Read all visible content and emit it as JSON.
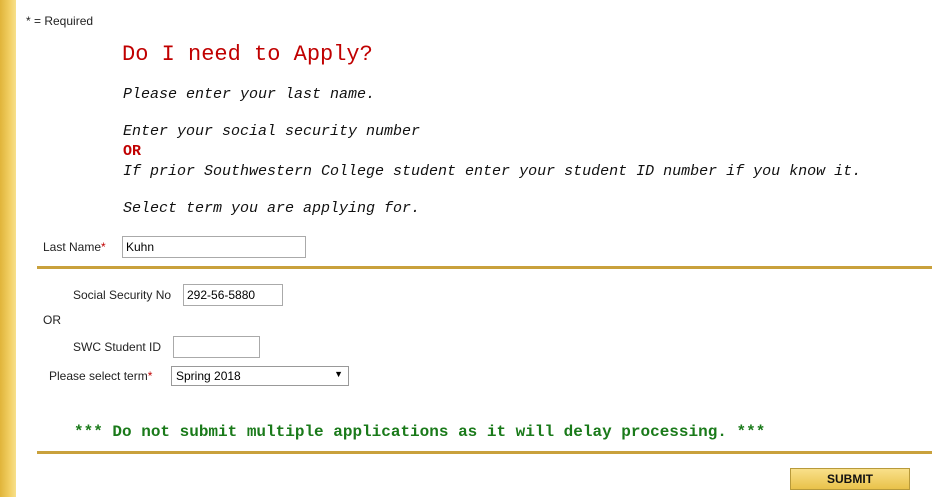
{
  "required_note": "* = Required",
  "heading": "Do I need to Apply?",
  "instructions": {
    "last_name": "Please enter your last name.",
    "ssn": "Enter your social security number",
    "or": "OR",
    "student_id": "If prior Southwestern College student enter your student ID number if you know it.",
    "term": "Select term you are applying for."
  },
  "form": {
    "last_name_label": "Last Name",
    "last_name_value": "Kuhn",
    "ssn_label": "Social Security No",
    "ssn_value": "292-56-5880",
    "or_label": "OR",
    "student_id_label": "SWC Student ID",
    "student_id_value": "",
    "term_label": "Please select term",
    "term_selected": "Spring 2018",
    "required_mark": "*"
  },
  "warning": "*** Do not submit multiple applications as it will delay processing. ***",
  "submit_label": "SUBMIT",
  "colors": {
    "accent_red": "#c00000",
    "warning_green": "#1a7a1a",
    "rule_gold": "#c9a13c"
  }
}
